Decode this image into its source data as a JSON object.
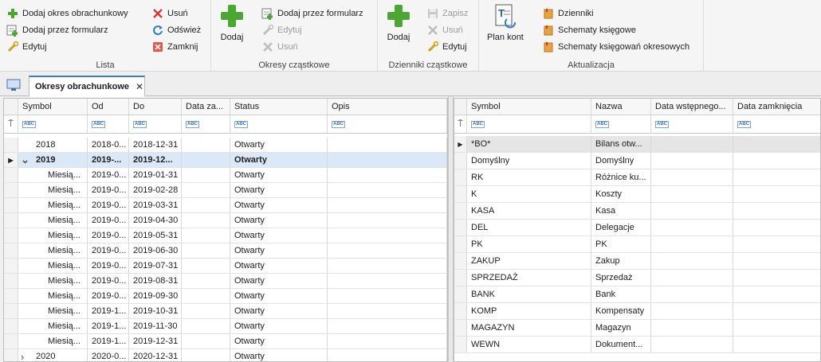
{
  "ribbon": {
    "lista": {
      "label": "Lista",
      "add_period": "Dodaj okres obrachunkowy",
      "add_form": "Dodaj przez formularz",
      "edit": "Edytuj",
      "delete": "Usuń",
      "refresh": "Odśwież",
      "close": "Zamknij"
    },
    "okresy": {
      "label": "Okresy cząstkowe",
      "add": "Dodaj",
      "add_form": "Dodaj przez formularz",
      "edit": "Edytuj",
      "delete": "Usuń"
    },
    "dzienniki": {
      "label": "Dzienniki cząstkowe",
      "add": "Dodaj",
      "save": "Zapisz",
      "delete": "Usuń",
      "edit": "Edytuj"
    },
    "aktualizacja": {
      "label": "Aktualizacja",
      "plan_kont": "Plan kont",
      "dzienniki": "Dzienniki",
      "schematy": "Schematy księgowe",
      "schematy_okresowe": "Schematy księgowań okresowych"
    }
  },
  "tab": {
    "title": "Okresy obrachunkowe",
    "close": "✕"
  },
  "left_grid": {
    "columns": [
      "Symbol",
      "Od",
      "Do",
      "Data za...",
      "Status",
      "Opis"
    ],
    "rows": [
      {
        "symbol": "2018",
        "od": "2018-0...",
        "do": "2018-12-31",
        "data": "",
        "status": "Otwarty",
        "opis": "",
        "expand": ""
      },
      {
        "symbol": "2019",
        "od": "2019-...",
        "do": "2019-12...",
        "data": "",
        "status": "Otwarty",
        "opis": "",
        "expand": "⌄"
      },
      {
        "symbol": "Miesią...",
        "od": "2019-0...",
        "do": "2019-01-31",
        "data": "",
        "status": "Otwarty",
        "opis": "",
        "expand": ""
      },
      {
        "symbol": "Miesią...",
        "od": "2019-0...",
        "do": "2019-02-28",
        "data": "",
        "status": "Otwarty",
        "opis": "",
        "expand": ""
      },
      {
        "symbol": "Miesią...",
        "od": "2019-0...",
        "do": "2019-03-31",
        "data": "",
        "status": "Otwarty",
        "opis": "",
        "expand": ""
      },
      {
        "symbol": "Miesią...",
        "od": "2019-0...",
        "do": "2019-04-30",
        "data": "",
        "status": "Otwarty",
        "opis": "",
        "expand": ""
      },
      {
        "symbol": "Miesią...",
        "od": "2019-0...",
        "do": "2019-05-31",
        "data": "",
        "status": "Otwarty",
        "opis": "",
        "expand": ""
      },
      {
        "symbol": "Miesią...",
        "od": "2019-0...",
        "do": "2019-06-30",
        "data": "",
        "status": "Otwarty",
        "opis": "",
        "expand": ""
      },
      {
        "symbol": "Miesią...",
        "od": "2019-0...",
        "do": "2019-07-31",
        "data": "",
        "status": "Otwarty",
        "opis": "",
        "expand": ""
      },
      {
        "symbol": "Miesią...",
        "od": "2019-0...",
        "do": "2019-08-31",
        "data": "",
        "status": "Otwarty",
        "opis": "",
        "expand": ""
      },
      {
        "symbol": "Miesią...",
        "od": "2019-0...",
        "do": "2019-09-30",
        "data": "",
        "status": "Otwarty",
        "opis": "",
        "expand": ""
      },
      {
        "symbol": "Miesią...",
        "od": "2019-1...",
        "do": "2019-10-31",
        "data": "",
        "status": "Otwarty",
        "opis": "",
        "expand": ""
      },
      {
        "symbol": "Miesią...",
        "od": "2019-1...",
        "do": "2019-11-30",
        "data": "",
        "status": "Otwarty",
        "opis": "",
        "expand": ""
      },
      {
        "symbol": "Miesią...",
        "od": "2019-1...",
        "do": "2019-12-31",
        "data": "",
        "status": "Otwarty",
        "opis": "",
        "expand": ""
      },
      {
        "symbol": "2020",
        "od": "2020-0...",
        "do": "2020-12-31",
        "data": "",
        "status": "Otwarty",
        "opis": "",
        "expand": "›"
      }
    ]
  },
  "right_grid": {
    "columns": [
      "Symbol",
      "Nazwa",
      "Data wstępnego...",
      "Data zamknięcia"
    ],
    "rows": [
      {
        "symbol": "*BO*",
        "nazwa": "Bilans otw...",
        "wst": "",
        "zam": ""
      },
      {
        "symbol": "Domyślny",
        "nazwa": "Domyślny",
        "wst": "",
        "zam": ""
      },
      {
        "symbol": "RK",
        "nazwa": "Różnice ku...",
        "wst": "",
        "zam": ""
      },
      {
        "symbol": "K",
        "nazwa": "Koszty",
        "wst": "",
        "zam": ""
      },
      {
        "symbol": "KASA",
        "nazwa": "Kasa",
        "wst": "",
        "zam": ""
      },
      {
        "symbol": "DEL",
        "nazwa": "Delegacje",
        "wst": "",
        "zam": ""
      },
      {
        "symbol": "PK",
        "nazwa": "PK",
        "wst": "",
        "zam": ""
      },
      {
        "symbol": "ZAKUP",
        "nazwa": "Zakup",
        "wst": "",
        "zam": ""
      },
      {
        "symbol": "SPRZEDAŻ",
        "nazwa": "Sprzedaż",
        "wst": "",
        "zam": ""
      },
      {
        "symbol": "BANK",
        "nazwa": "Bank",
        "wst": "",
        "zam": ""
      },
      {
        "symbol": "KOMP",
        "nazwa": "Kompensaty",
        "wst": "",
        "zam": ""
      },
      {
        "symbol": "MAGAZYN",
        "nazwa": "Magazyn",
        "wst": "",
        "zam": ""
      },
      {
        "symbol": "WEWN",
        "nazwa": "Dokument...",
        "wst": "",
        "zam": ""
      }
    ]
  },
  "filter_icon_text": "ABC",
  "colors": {
    "accent": "#3a7bd5",
    "green": "#4aa832",
    "red": "#d9382f",
    "selection": "#dbe8f7"
  }
}
